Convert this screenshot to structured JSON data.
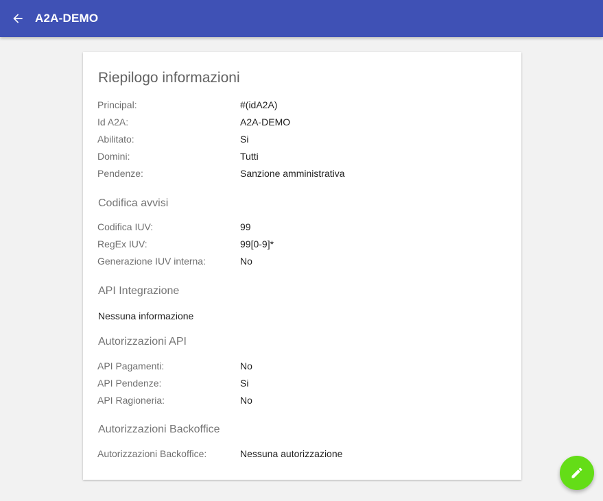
{
  "header": {
    "title": "A2A-DEMO",
    "back_icon": "arrow-back-icon",
    "background_color": "#3f51b5"
  },
  "card": {
    "title": "Riepilogo informazioni",
    "general": [
      {
        "label": "Principal:",
        "value": "#(idA2A)"
      },
      {
        "label": "Id A2A:",
        "value": "A2A-DEMO"
      },
      {
        "label": "Abilitato:",
        "value": "Si"
      },
      {
        "label": "Domini:",
        "value": "Tutti"
      },
      {
        "label": "Pendenze:",
        "value": "Sanzione amministrativa"
      }
    ],
    "codifica_avvisi": {
      "title": "Codifica avvisi",
      "rows": [
        {
          "label": "Codifica IUV:",
          "value": "99"
        },
        {
          "label": "RegEx IUV:",
          "value": "99[0-9]*"
        },
        {
          "label": "Generazione IUV interna:",
          "value": "No"
        }
      ]
    },
    "api_integrazione": {
      "title": "API Integrazione",
      "empty_message": "Nessuna informazione"
    },
    "autorizzazioni_api": {
      "title": "Autorizzazioni API",
      "rows": [
        {
          "label": "API Pagamenti:",
          "value": "No"
        },
        {
          "label": "API Pendenze:",
          "value": "Si"
        },
        {
          "label": "API Ragioneria:",
          "value": "No"
        }
      ]
    },
    "autorizzazioni_backoffice": {
      "title": "Autorizzazioni Backoffice",
      "rows": [
        {
          "label": "Autorizzazioni Backoffice:",
          "value": "Nessuna autorizzazione"
        }
      ]
    }
  },
  "fab": {
    "icon": "edit-pencil-icon",
    "color": "#64dd17"
  }
}
